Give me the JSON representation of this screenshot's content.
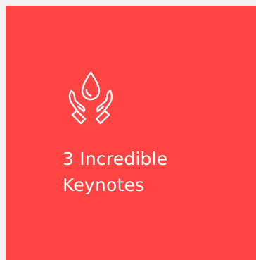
{
  "card": {
    "background_color": "#ff4444",
    "text_color": "#ffffff",
    "icon": "hands-holding-drop-icon",
    "title_line1": "3 Incredible",
    "title_line2": "Keynotes"
  }
}
